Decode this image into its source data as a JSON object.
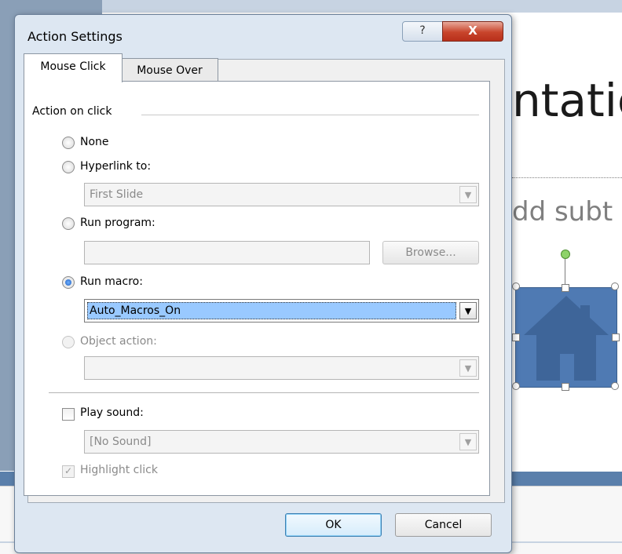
{
  "slide": {
    "title_fragment": "ntatic",
    "subtitle_fragment": "dd subt"
  },
  "dialog": {
    "title": "Action Settings",
    "help_label": "?",
    "close_label": "X",
    "tabs": [
      {
        "label": "Mouse Click",
        "selected": true
      },
      {
        "label": "Mouse Over",
        "selected": false
      }
    ],
    "group_label": "Action on click",
    "options": {
      "none": {
        "label": "None",
        "checked": false
      },
      "hyperlink": {
        "label": "Hyperlink to:",
        "checked": false,
        "value": "First Slide"
      },
      "run_program": {
        "label": "Run program:",
        "checked": false,
        "value": "",
        "browse_label": "Browse..."
      },
      "run_macro": {
        "label": "Run macro:",
        "checked": true,
        "value": "Auto_Macros_On"
      },
      "object_action": {
        "label": "Object action:",
        "checked": false,
        "enabled": false,
        "value": ""
      }
    },
    "play_sound": {
      "label": "Play sound:",
      "checked": false,
      "value": "[No Sound]"
    },
    "highlight_click": {
      "label": "Highlight click",
      "checked": true,
      "enabled": false
    },
    "ok_label": "OK",
    "cancel_label": "Cancel"
  },
  "icons": [
    "help-icon",
    "close-icon",
    "dropdown-arrow-icon",
    "house-icon"
  ]
}
